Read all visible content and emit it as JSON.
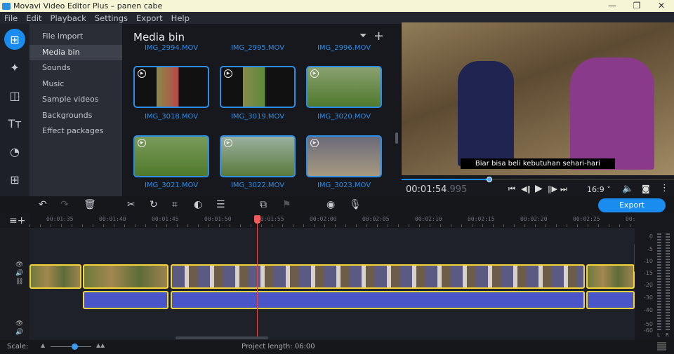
{
  "title": "Movavi Video Editor Plus – panen cabe",
  "menu": [
    "File",
    "Edit",
    "Playback",
    "Settings",
    "Export",
    "Help"
  ],
  "rail_icons": [
    "import-icon",
    "magic-wand-icon",
    "transitions-icon",
    "titles-icon",
    "stickers-icon",
    "more-tools-icon"
  ],
  "submenu": [
    "File import",
    "Media bin",
    "Sounds",
    "Music",
    "Sample videos",
    "Backgrounds",
    "Effect packages"
  ],
  "bin": {
    "title": "Media bin",
    "top_row": [
      "IMG_2994.MOV",
      "IMG_2995.MOV",
      "IMG_2996.MOV"
    ],
    "items": [
      "IMG_3018.MOV",
      "IMG_3019.MOV",
      "IMG_3020.MOV",
      "IMG_3021.MOV",
      "IMG_3022.MOV",
      "IMG_3023.MOV"
    ]
  },
  "preview": {
    "subtitle": "Biar bisa beli kebutuhan sehari-hari",
    "time_main": "00:01:54",
    "time_ms": ".995",
    "aspect": "16:9 ˅",
    "progress": 0.33
  },
  "export_label": "Export",
  "ruler": [
    "00:01:35",
    "00:01:40",
    "00:01:45",
    "00:01:50",
    "00:01:55",
    "00:02:00",
    "00:02:05",
    "00:02:10",
    "00:02:15",
    "00:02:20",
    "00:02:25",
    "00:"
  ],
  "meter": {
    "labels": [
      "0",
      "-5",
      "-10",
      "-15",
      "-20",
      "-30",
      "-40",
      "-50",
      "-60"
    ],
    "l": "L",
    "r": "R"
  },
  "bottom": {
    "scale": "Scale:",
    "project_length": "Project length: 06:00"
  },
  "colors": {
    "accent": "#1a8cf0",
    "clip_border": "#f0d43a",
    "playhead": "#e04848",
    "audio": "#4a55c8"
  }
}
